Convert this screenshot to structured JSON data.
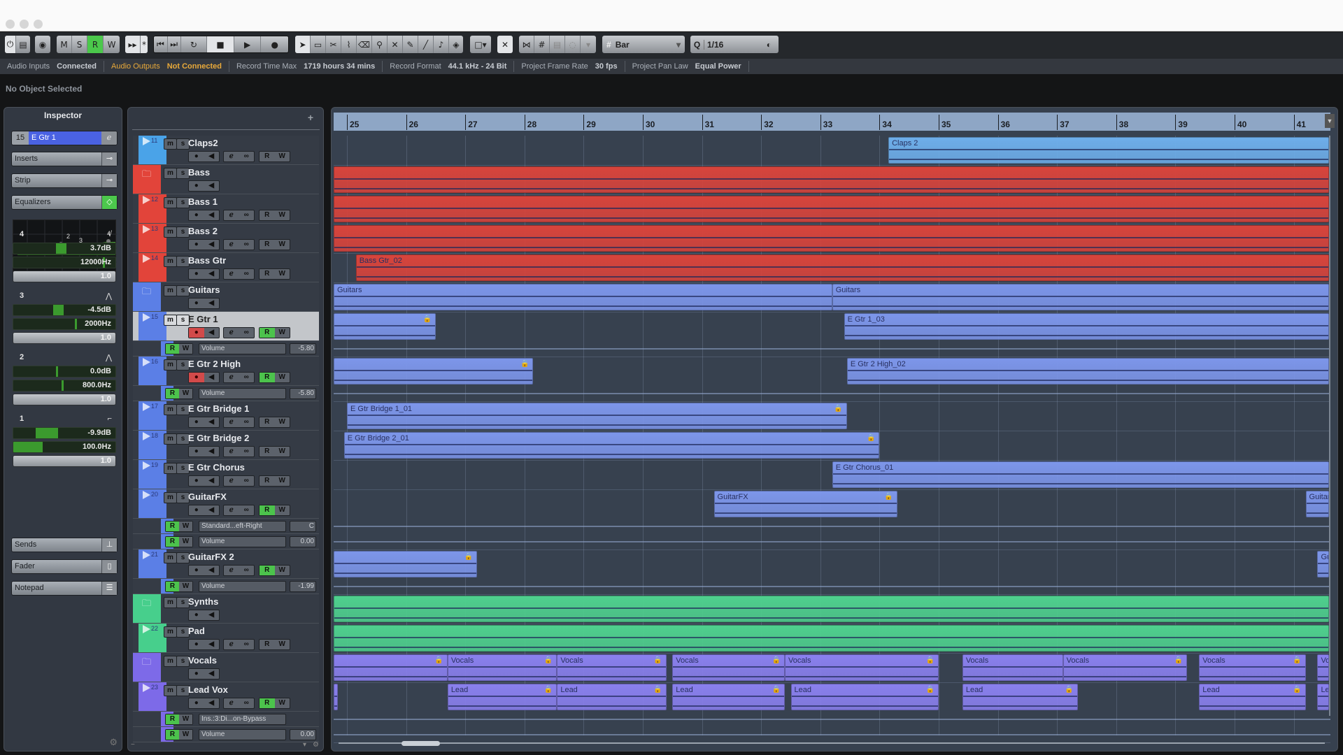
{
  "window": {
    "traffic_lights": [
      "close",
      "minimize",
      "zoom"
    ]
  },
  "toolbar": {
    "mode_buttons": [
      "M",
      "S",
      "R",
      "W"
    ],
    "active_mode": "R",
    "transport": [
      "go-to-start",
      "go-to-end",
      "cycle",
      "stop",
      "play",
      "record"
    ],
    "tools": [
      "object-select",
      "range",
      "split",
      "glue",
      "erase",
      "zoom",
      "mute",
      "draw",
      "line",
      "play-speaker",
      "color"
    ],
    "grid_type": "Bar",
    "quantize": "1/16"
  },
  "infoline": {
    "audio_inputs_label": "Audio Inputs",
    "audio_inputs_value": "Connected",
    "audio_outputs_label": "Audio Outputs",
    "audio_outputs_value": "Not Connected",
    "record_time_label": "Record Time Max",
    "record_time_value": "1719 hours 34 mins",
    "record_format_label": "Record Format",
    "record_format_value": "44.1 kHz - 24 Bit",
    "frame_rate_label": "Project Frame Rate",
    "frame_rate_value": "30 fps",
    "pan_law_label": "Project Pan Law",
    "pan_law_value": "Equal Power"
  },
  "status": {
    "selection": "No Object Selected"
  },
  "inspector": {
    "title": "Inspector",
    "track_number": "15",
    "track_name": "E Gtr 1",
    "sections": [
      "Inserts",
      "Strip",
      "Equalizers",
      "Sends",
      "Fader",
      "Notepad"
    ],
    "eq_graph_labels": [
      "1",
      "2",
      "3",
      "4"
    ],
    "eq_bands": [
      {
        "band": "4",
        "shape": "high-shelf",
        "gain": "3.7dB",
        "freq": "12000Hz",
        "q": "1.0",
        "gain_pos": 0.5,
        "freq_pos": 0.88
      },
      {
        "band": "3",
        "shape": "peak",
        "gain": "-4.5dB",
        "freq": "2000Hz",
        "q": "1.0",
        "gain_pos": 0.47,
        "freq_pos": 0.6
      },
      {
        "band": "2",
        "shape": "peak",
        "gain": "0.0dB",
        "freq": "800.0Hz",
        "q": "1.0",
        "gain_pos": 0.5,
        "freq_pos": 0.47
      },
      {
        "band": "1",
        "shape": "low-shelf",
        "gain": "-9.9dB",
        "freq": "100.0Hz",
        "q": "1.0",
        "gain_pos": 0.3,
        "freq_pos": 0.29
      }
    ]
  },
  "tracklist": {
    "tracks": [
      {
        "num": "11",
        "name": "Claps2",
        "type": "audio",
        "color": "#4aa3e8",
        "monitor_r": false,
        "rec": false
      },
      {
        "num": "",
        "name": "Bass",
        "type": "folder",
        "color": "#e2443a"
      },
      {
        "num": "12",
        "name": "Bass 1",
        "type": "audio",
        "color": "#e2443a"
      },
      {
        "num": "13",
        "name": "Bass 2",
        "type": "audio",
        "color": "#e2443a"
      },
      {
        "num": "14",
        "name": "Bass Gtr",
        "type": "audio",
        "color": "#e2443a"
      },
      {
        "num": "",
        "name": "Guitars",
        "type": "folder",
        "color": "#5b7fe6"
      },
      {
        "num": "15",
        "name": "E Gtr 1",
        "type": "audio",
        "color": "#5b7fe6",
        "selected": true,
        "rec": true,
        "read": true,
        "automation": [
          {
            "param": "Volume",
            "value": "-5.80"
          }
        ]
      },
      {
        "num": "16",
        "name": "E Gtr 2 High",
        "type": "audio",
        "color": "#5b7fe6",
        "rec": true,
        "read": true,
        "automation": [
          {
            "param": "Volume",
            "value": "-5.80"
          }
        ]
      },
      {
        "num": "17",
        "name": "E Gtr Bridge 1",
        "type": "audio",
        "color": "#5b7fe6"
      },
      {
        "num": "18",
        "name": "E Gtr Bridge 2",
        "type": "audio",
        "color": "#5b7fe6"
      },
      {
        "num": "19",
        "name": "E Gtr Chorus",
        "type": "audio",
        "color": "#5b7fe6"
      },
      {
        "num": "20",
        "name": "GuitarFX",
        "type": "audio",
        "color": "#5b7fe6",
        "read": true,
        "automation": [
          {
            "param": "Standard...eft-Right",
            "value": "C"
          },
          {
            "param": "Volume",
            "value": "0.00"
          }
        ]
      },
      {
        "num": "21",
        "name": "GuitarFX 2",
        "type": "audio",
        "color": "#5b7fe6",
        "read": true,
        "automation": [
          {
            "param": "Volume",
            "value": "-1.99"
          }
        ]
      },
      {
        "num": "",
        "name": "Synths",
        "type": "folder",
        "color": "#47cf8c"
      },
      {
        "num": "22",
        "name": "Pad",
        "type": "audio",
        "color": "#47cf8c"
      },
      {
        "num": "",
        "name": "Vocals",
        "type": "folder",
        "color": "#7d6ae8"
      },
      {
        "num": "23",
        "name": "Lead Vox",
        "type": "audio",
        "color": "#7d6ae8",
        "read": true,
        "automation": [
          {
            "param": "Ins.:3:Di...on-Bypass",
            "value": ""
          },
          {
            "param": "Volume",
            "value": "0.00"
          }
        ]
      }
    ]
  },
  "ruler": {
    "bars": [
      "25",
      "26",
      "27",
      "28",
      "29",
      "30",
      "31",
      "32",
      "33",
      "34",
      "35",
      "36",
      "37",
      "38",
      "39",
      "40",
      "41"
    ]
  },
  "clips": [
    {
      "track": "Claps2",
      "label": "Claps 2",
      "start_bar": 34.15,
      "end_bar": 41.6,
      "color": "#6eaeea"
    },
    {
      "track": "Bass",
      "label": "",
      "start_bar": 24.7,
      "end_bar": 41.6,
      "color": "#d8443c"
    },
    {
      "track": "Bass 1",
      "label": "",
      "start_bar": 24.7,
      "end_bar": 41.6,
      "color": "#d8443c"
    },
    {
      "track": "Bass 2",
      "label": "",
      "start_bar": 24.7,
      "end_bar": 41.6,
      "color": "#d8443c"
    },
    {
      "track": "Bass Gtr",
      "label": "Bass Gtr_02",
      "start_bar": 25.15,
      "end_bar": 41.6,
      "color": "#d8443c"
    },
    {
      "track": "Guitars",
      "label": "Guitars",
      "start_bar": 24.7,
      "end_bar": 33.2,
      "color": "#7d96ea"
    },
    {
      "track": "Guitars",
      "label": "Guitars",
      "start_bar": 33.2,
      "end_bar": 41.6,
      "color": "#7d96ea"
    },
    {
      "track": "E Gtr 1",
      "label": "",
      "start_bar": 24.7,
      "end_bar": 26.5,
      "color": "#7d96ea",
      "locked": true
    },
    {
      "track": "E Gtr 1",
      "label": "E Gtr 1_03",
      "start_bar": 33.4,
      "end_bar": 41.6,
      "color": "#7d96ea"
    },
    {
      "track": "E Gtr 2 High",
      "label": "",
      "start_bar": 24.7,
      "end_bar": 28.15,
      "color": "#7d96ea",
      "locked": true
    },
    {
      "track": "E Gtr 2 High",
      "label": "E Gtr 2 High_02",
      "start_bar": 33.45,
      "end_bar": 41.6,
      "color": "#7d96ea"
    },
    {
      "track": "E Gtr Bridge 1",
      "label": "E Gtr Bridge 1_01",
      "start_bar": 25.0,
      "end_bar": 33.45,
      "color": "#7d96ea",
      "locked": true
    },
    {
      "track": "E Gtr Bridge 2",
      "label": "E Gtr Bridge 2_01",
      "start_bar": 24.95,
      "end_bar": 34.0,
      "color": "#7d96ea",
      "locked": true
    },
    {
      "track": "E Gtr Chorus",
      "label": "E Gtr Chorus_01",
      "start_bar": 33.2,
      "end_bar": 41.6,
      "color": "#7d96ea"
    },
    {
      "track": "GuitarFX",
      "label": "GuitarFX",
      "start_bar": 31.2,
      "end_bar": 34.3,
      "color": "#7d96ea",
      "locked": true
    },
    {
      "track": "GuitarFX",
      "label": "Guitar",
      "start_bar": 41.2,
      "end_bar": 41.6,
      "color": "#7d96ea"
    },
    {
      "track": "GuitarFX 2",
      "label": "",
      "start_bar": 24.7,
      "end_bar": 27.2,
      "color": "#7d96ea",
      "locked": true
    },
    {
      "track": "GuitarFX 2",
      "label": "Gu",
      "start_bar": 41.4,
      "end_bar": 41.6,
      "color": "#7d96ea"
    },
    {
      "track": "Synths",
      "label": "",
      "start_bar": 24.7,
      "end_bar": 41.6,
      "color": "#4fd08e"
    },
    {
      "track": "Pad",
      "label": "",
      "start_bar": 24.7,
      "end_bar": 41.6,
      "color": "#4fd08e"
    },
    {
      "track": "Vocals",
      "label": "",
      "start_bar": 24.7,
      "end_bar": 26.7,
      "color": "#8a80ee",
      "locked": true
    },
    {
      "track": "Vocals",
      "label": "Vocals",
      "start_bar": 26.7,
      "end_bar": 28.55,
      "color": "#8a80ee",
      "locked": true
    },
    {
      "track": "Vocals",
      "label": "Vocals",
      "start_bar": 28.55,
      "end_bar": 30.4,
      "color": "#8a80ee",
      "locked": true
    },
    {
      "track": "Vocals",
      "label": "Vocals",
      "start_bar": 30.5,
      "end_bar": 32.4,
      "color": "#8a80ee",
      "locked": true
    },
    {
      "track": "Vocals",
      "label": "Vocals",
      "start_bar": 32.4,
      "end_bar": 35.0,
      "color": "#8a80ee",
      "locked": true
    },
    {
      "track": "Vocals",
      "label": "Vocals",
      "start_bar": 35.4,
      "end_bar": 37.1,
      "color": "#8a80ee"
    },
    {
      "track": "Vocals",
      "label": "Vocals",
      "start_bar": 37.1,
      "end_bar": 39.2,
      "color": "#8a80ee",
      "locked": true
    },
    {
      "track": "Vocals",
      "label": "Vocals",
      "start_bar": 39.4,
      "end_bar": 41.2,
      "color": "#8a80ee",
      "locked": true
    },
    {
      "track": "Vocals",
      "label": "Vo",
      "start_bar": 41.4,
      "end_bar": 41.6,
      "color": "#8a80ee"
    },
    {
      "track": "Lead Vox",
      "label": "",
      "start_bar": 24.7,
      "end_bar": 24.85,
      "color": "#8a80ee",
      "locked": true
    },
    {
      "track": "Lead Vox",
      "label": "Lead",
      "start_bar": 26.7,
      "end_bar": 28.55,
      "color": "#8a80ee",
      "locked": true
    },
    {
      "track": "Lead Vox",
      "label": "Lead",
      "start_bar": 28.55,
      "end_bar": 30.4,
      "color": "#8a80ee",
      "locked": true
    },
    {
      "track": "Lead Vox",
      "label": "Lead",
      "start_bar": 30.5,
      "end_bar": 32.4,
      "color": "#8a80ee",
      "locked": true
    },
    {
      "track": "Lead Vox",
      "label": "Lead",
      "start_bar": 32.5,
      "end_bar": 35.0,
      "color": "#8a80ee",
      "locked": true
    },
    {
      "track": "Lead Vox",
      "label": "Lead",
      "start_bar": 35.4,
      "end_bar": 37.35,
      "color": "#8a80ee",
      "locked": true
    },
    {
      "track": "Lead Vox",
      "label": "Lead",
      "start_bar": 39.4,
      "end_bar": 41.2,
      "color": "#8a80ee",
      "locked": true
    },
    {
      "track": "Lead Vox",
      "label": "Le",
      "start_bar": 41.4,
      "end_bar": 41.6,
      "color": "#8a80ee"
    }
  ]
}
